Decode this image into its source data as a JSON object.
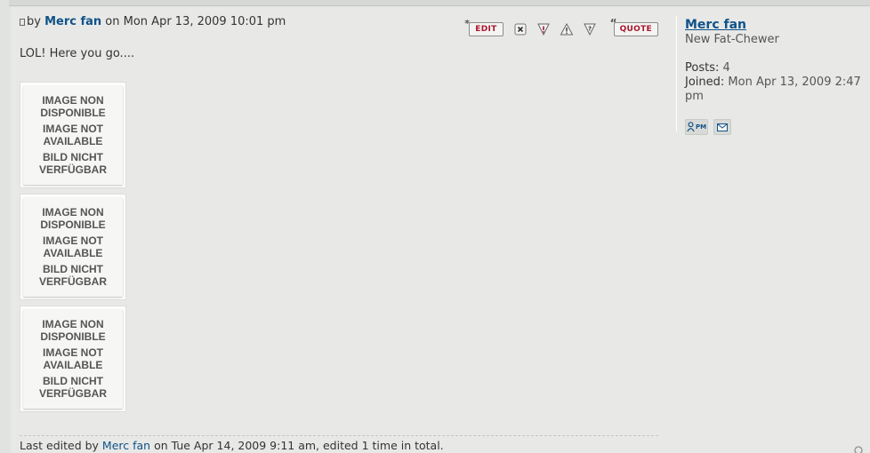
{
  "post": {
    "by_prefix": "by ",
    "author": "Merc fan",
    "date_prefix": " on ",
    "date": "Mon Apr 13, 2009 10:01 pm",
    "message": "LOL! Here you go....",
    "buttons": {
      "edit": "EDIT",
      "quote": "QUOTE",
      "delete_icon": "delete-icon",
      "report_icon": "report-icon",
      "warn_icon": "warn-icon",
      "info_icon": "info-icon"
    },
    "attachments": [
      {
        "lines": [
          "IMAGE NON",
          "DISPONIBLE",
          "IMAGE NOT",
          "AVAILABLE",
          "BILD NICHT",
          "VERFÜGBAR"
        ]
      },
      {
        "lines": [
          "IMAGE NON",
          "DISPONIBLE",
          "IMAGE NOT",
          "AVAILABLE",
          "BILD NICHT",
          "VERFÜGBAR"
        ]
      },
      {
        "lines": [
          "IMAGE NON",
          "DISPONIBLE",
          "IMAGE NOT",
          "AVAILABLE",
          "BILD NICHT",
          "VERFÜGBAR"
        ]
      }
    ],
    "edited": {
      "prefix": "Last edited by ",
      "user": "Merc fan",
      "suffix": " on Tue Apr 14, 2009 9:11 am, edited 1 time in total."
    }
  },
  "profile": {
    "name": "Merc fan",
    "rank": "New Fat-Chewer",
    "posts_label": "Posts:",
    "posts_value": " 4",
    "joined_label": "Joined:",
    "joined_value": " Mon Apr 13, 2009 2:47 pm",
    "pm_label": "PM"
  },
  "colors": {
    "link": "#105289",
    "button_text": "#a8162f",
    "background": "#e8e9e7"
  }
}
